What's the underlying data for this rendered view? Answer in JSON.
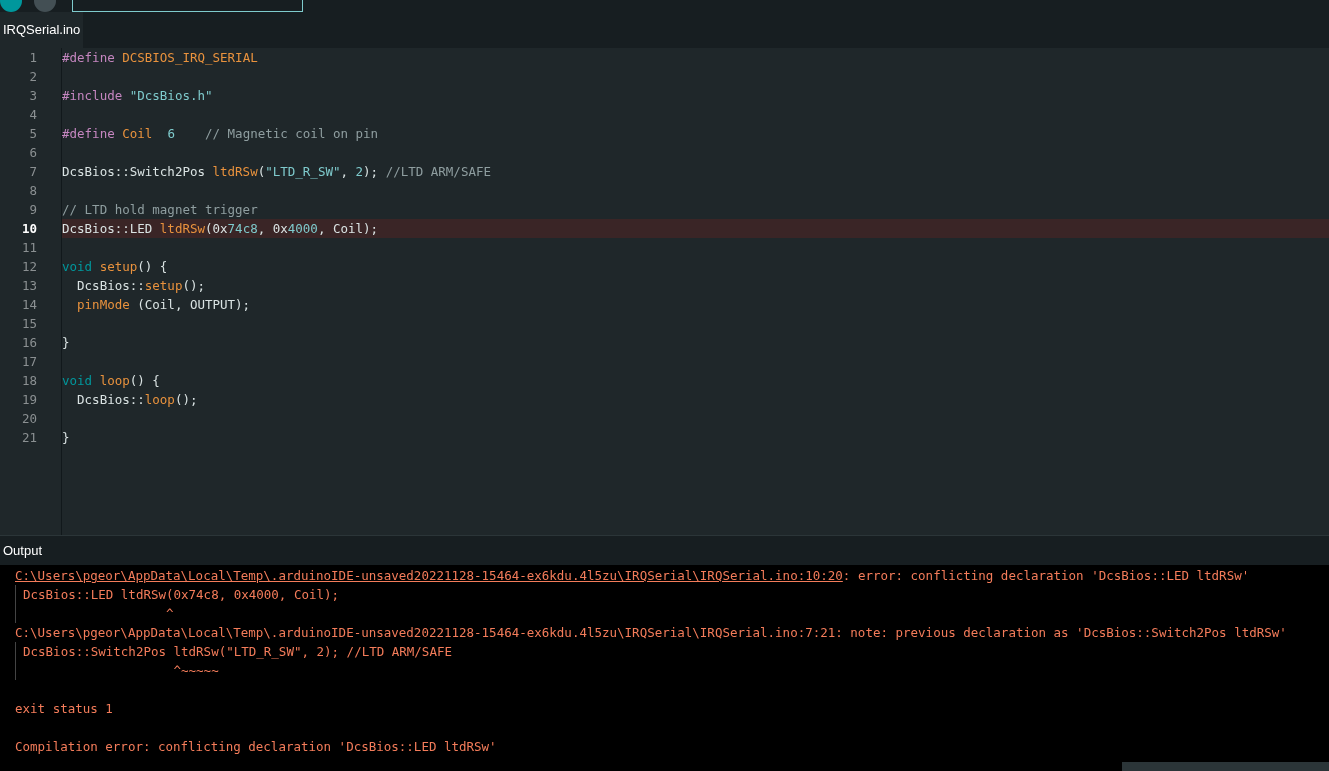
{
  "tabs": [
    {
      "label": "IRQSerial.ino",
      "selected": true
    }
  ],
  "editor": {
    "lines": [
      {
        "number": "1",
        "highlighted": false,
        "tokens": [
          {
            "kind": "directive",
            "text": "#define "
          },
          {
            "kind": "name",
            "text": "DCSBIOS_IRQ_SERIAL"
          }
        ]
      },
      {
        "number": "2",
        "highlighted": false
      },
      {
        "number": "3",
        "highlighted": false,
        "tokens": [
          {
            "kind": "directive",
            "text": "#include "
          },
          {
            "kind": "literal",
            "text": "\"DcsBios.h\""
          }
        ]
      },
      {
        "number": "4",
        "highlighted": false
      },
      {
        "number": "5",
        "highlighted": false,
        "tokens": [
          {
            "kind": "directive",
            "text": "#define "
          },
          {
            "kind": "name",
            "text": "Coil  "
          },
          {
            "kind": "literal",
            "text": "6    "
          },
          {
            "kind": "comment",
            "text": "// Magnetic coil on pin"
          }
        ]
      },
      {
        "number": "6",
        "highlighted": false
      },
      {
        "number": "7",
        "highlighted": false,
        "tokens": [
          {
            "kind": "plain",
            "text": "DcsBios::Switch2Pos "
          },
          {
            "kind": "name",
            "text": "ltdRSw"
          },
          {
            "kind": "plain",
            "text": "("
          },
          {
            "kind": "literal",
            "text": "\"LTD_R_SW\""
          },
          {
            "kind": "plain",
            "text": ", "
          },
          {
            "kind": "literal",
            "text": "2"
          },
          {
            "kind": "plain",
            "text": "); "
          },
          {
            "kind": "comment",
            "text": "//LTD ARM/SAFE"
          }
        ]
      },
      {
        "number": "8",
        "highlighted": false
      },
      {
        "number": "9",
        "highlighted": false,
        "tokens": [
          {
            "kind": "comment",
            "text": "// LTD hold magnet trigger"
          }
        ]
      },
      {
        "number": "10",
        "highlighted": true,
        "tokens": [
          {
            "kind": "plain",
            "text": "DcsBios::LED "
          },
          {
            "kind": "name",
            "text": "ltdRSw"
          },
          {
            "kind": "plain",
            "text": "(0x"
          },
          {
            "kind": "literal",
            "text": "74c8"
          },
          {
            "kind": "plain",
            "text": ", 0x"
          },
          {
            "kind": "literal",
            "text": "4000"
          },
          {
            "kind": "plain",
            "text": ", Coil);"
          }
        ]
      },
      {
        "number": "11",
        "highlighted": false
      },
      {
        "number": "12",
        "highlighted": false,
        "tokens": [
          {
            "kind": "type",
            "text": "void "
          },
          {
            "kind": "name",
            "text": "setup"
          },
          {
            "kind": "plain",
            "text": "() {"
          }
        ]
      },
      {
        "number": "13",
        "highlighted": false,
        "tokens": [
          {
            "kind": "plain",
            "text": "  DcsBios::"
          },
          {
            "kind": "name",
            "text": "setup"
          },
          {
            "kind": "plain",
            "text": "();"
          }
        ]
      },
      {
        "number": "14",
        "highlighted": false,
        "tokens": [
          {
            "kind": "name",
            "text": "  pinMode"
          },
          {
            "kind": "plain",
            "text": " (Coil, OUTPUT);"
          }
        ]
      },
      {
        "number": "15",
        "highlighted": false
      },
      {
        "number": "16",
        "highlighted": false,
        "tokens": [
          {
            "kind": "plain",
            "text": "}"
          }
        ]
      },
      {
        "number": "17",
        "highlighted": false
      },
      {
        "number": "18",
        "highlighted": false,
        "tokens": [
          {
            "kind": "type",
            "text": "void "
          },
          {
            "kind": "name",
            "text": "loop"
          },
          {
            "kind": "plain",
            "text": "() {"
          }
        ]
      },
      {
        "number": "19",
        "highlighted": false,
        "tokens": [
          {
            "kind": "plain",
            "text": "  DcsBios::"
          },
          {
            "kind": "name",
            "text": "loop"
          },
          {
            "kind": "plain",
            "text": "();"
          }
        ]
      },
      {
        "number": "20",
        "highlighted": false
      },
      {
        "number": "21",
        "highlighted": false,
        "tokens": [
          {
            "kind": "plain",
            "text": "}"
          }
        ]
      }
    ]
  },
  "output": {
    "title": "Output",
    "lines": [
      {
        "kind": "location",
        "link": "C:\\Users\\pgeor\\AppData\\Local\\Temp\\.arduinoIDE-unsaved20221128-15464-ex6kdu.4l5zu\\IRQSerial\\IRQSerial.ino:10:20",
        "text": ": error: conflicting declaration 'DcsBios::LED ltdRSw'"
      },
      {
        "kind": "code",
        "text": "DcsBios::LED ltdRSw(0x74c8, 0x4000, Coil);"
      },
      {
        "kind": "code",
        "text": "                   ^"
      },
      {
        "kind": "location",
        "text": "C:\\Users\\pgeor\\AppData\\Local\\Temp\\.arduinoIDE-unsaved20221128-15464-ex6kdu.4l5zu\\IRQSerial\\IRQSerial.ino:7:21: note: previous declaration as 'DcsBios::Switch2Pos ltdRSw'"
      },
      {
        "kind": "code",
        "text": "DcsBios::Switch2Pos ltdRSw(\"LTD_R_SW\", 2); //LTD ARM/SAFE"
      },
      {
        "kind": "code",
        "text": "                    ^~~~~~"
      },
      {
        "kind": "blank"
      },
      {
        "kind": "message",
        "text": "exit status 1"
      },
      {
        "kind": "blank"
      },
      {
        "kind": "message",
        "text": "Compilation error: conflicting declaration 'DcsBios::LED ltdRSw'"
      }
    ]
  }
}
